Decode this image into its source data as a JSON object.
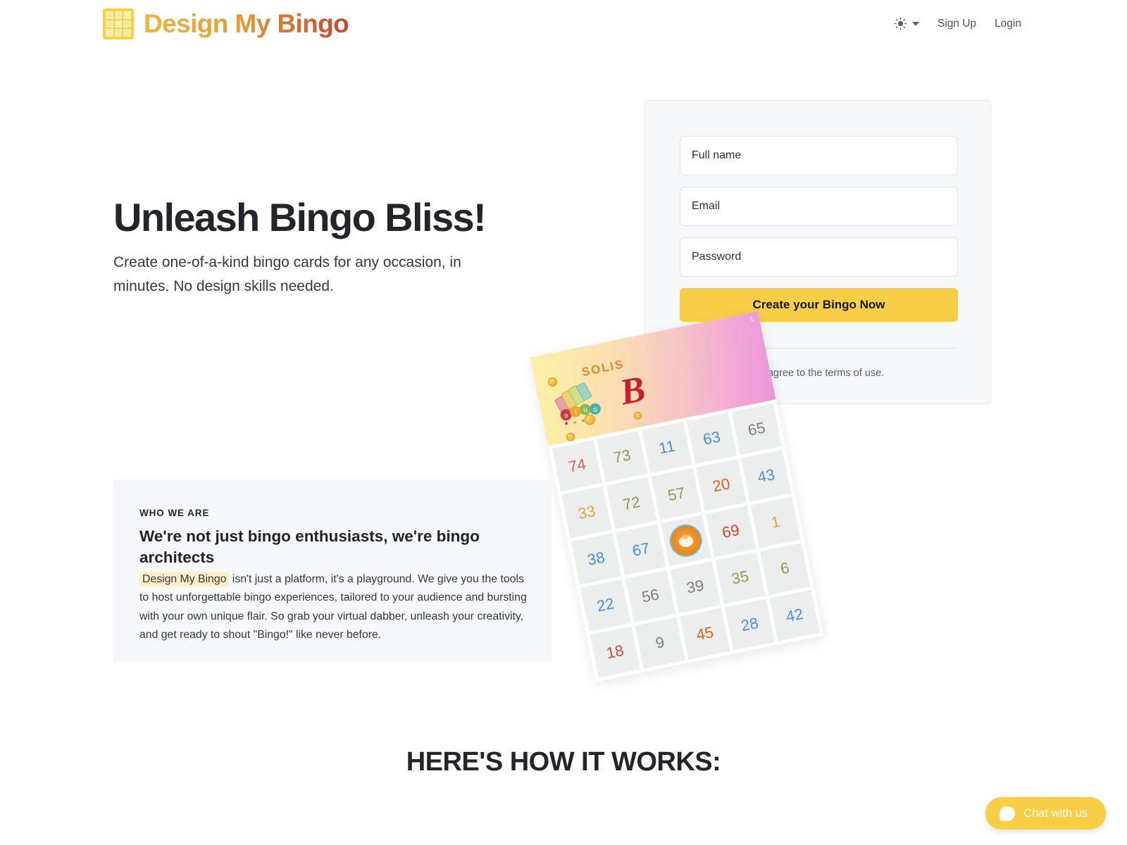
{
  "header": {
    "brand_name": "Design My Bingo",
    "logo_icon": "bingo-grid-icon",
    "theme_icon": "sun-icon",
    "sign_up_label": "Sign Up",
    "login_label": "Login"
  },
  "hero": {
    "title": "Unleash Bingo Bliss!",
    "subtitle": "Create one-of-a-kind bingo cards for any occasion, in minutes. No design skills needed."
  },
  "signup": {
    "fullname_placeholder": "Full name",
    "fullname_value": "",
    "email_placeholder": "Email",
    "email_value": "",
    "password_placeholder": "Password",
    "password_value": "",
    "cta_label": "Create your Bingo Now",
    "terms": "By Signing up, you agree to the terms of use."
  },
  "bingo_art": {
    "header_title": "SOLIS",
    "header_script": "B",
    "corner_badge": "1",
    "free_space_icon": "lion-head-icon",
    "balls_icon": "bingo-balls-icon",
    "grid": [
      [
        {
          "n": "74",
          "c": "#d06a45"
        },
        {
          "n": "73",
          "c": "#8e9c4c"
        },
        {
          "n": "11",
          "c": "#4a90d9"
        },
        {
          "n": "63",
          "c": "#4a90d9"
        },
        {
          "n": "65",
          "c": "#7a7f85"
        }
      ],
      [
        {
          "n": "33",
          "c": "#e0a33f"
        },
        {
          "n": "72",
          "c": "#8e9c4c"
        },
        {
          "n": "57",
          "c": "#8e9c4c"
        },
        {
          "n": "20",
          "c": "#d9601f"
        },
        {
          "n": "43",
          "c": "#4a90d9"
        }
      ],
      [
        {
          "n": "38",
          "c": "#4a90d9"
        },
        {
          "n": "67",
          "c": "#4a90d9"
        },
        {
          "n": "",
          "c": ""
        },
        {
          "n": "69",
          "c": "#d0482e"
        },
        {
          "n": "1",
          "c": "#e0a33f"
        }
      ],
      [
        {
          "n": "22",
          "c": "#4a90d9"
        },
        {
          "n": "56",
          "c": "#7a7f85"
        },
        {
          "n": "39",
          "c": "#7a7f85"
        },
        {
          "n": "35",
          "c": "#8e9c4c"
        },
        {
          "n": "6",
          "c": "#8e9c4c"
        }
      ],
      [
        {
          "n": "18",
          "c": "#d0482e"
        },
        {
          "n": "9",
          "c": "#7a7f85"
        },
        {
          "n": "45",
          "c": "#d9601f"
        },
        {
          "n": "28",
          "c": "#4a90d9"
        },
        {
          "n": "42",
          "c": "#4a90d9"
        }
      ]
    ]
  },
  "who_we_are": {
    "eyebrow": "WHO WE ARE",
    "heading": "We're not just bingo enthusiasts, we're bingo architects",
    "highlight": "Design My Bingo",
    "body": " isn't just a platform, it's a playground. We give you the tools to host unforgettable bingo experiences, tailored to your audience and bursting with your own unique flair. So grab your virtual dabber, unleash your creativity, and get ready to shout \"Bingo!\" like never before."
  },
  "how_it_works": {
    "title": "HERE'S HOW IT WORKS:"
  },
  "chat": {
    "label": "Chat with us",
    "icon": "chat-bubble-icon"
  },
  "colors": {
    "brand_yellow": "#f5d041",
    "brand_orange": "#e79c34",
    "brand_red": "#c8452e",
    "cta_yellow": "#f7ce46",
    "panel_bg": "#f5f7fb",
    "card_bg": "#f7f8fa",
    "highlight_bg": "#fdf0c8"
  }
}
